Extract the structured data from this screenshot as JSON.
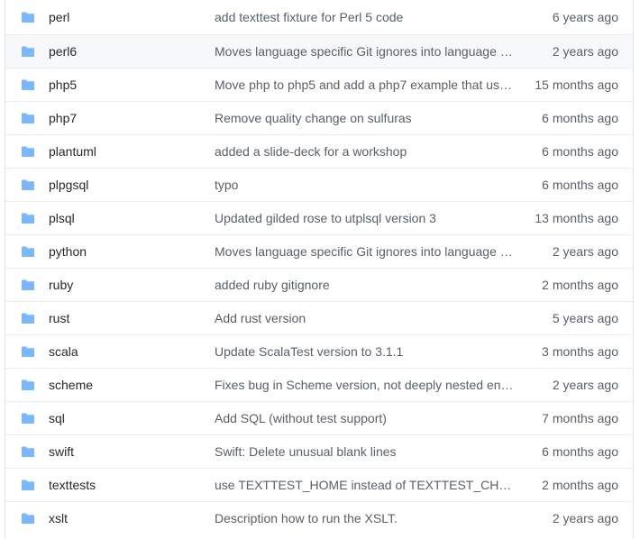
{
  "colors": {
    "folder_icon": "#79b8ff",
    "row_border": "#eaecef",
    "name_text": "#24292e",
    "meta_text": "#586069",
    "hover_bg": "#f6f8fa"
  },
  "rows": [
    {
      "name": "perl",
      "icon": "folder-icon",
      "message": "add texttest fixture for Perl 5 code",
      "age": "6 years ago"
    },
    {
      "name": "perl6",
      "icon": "folder-icon",
      "message": "Moves language specific Git ignores into language s…",
      "age": "2 years ago"
    },
    {
      "name": "php5",
      "icon": "folder-icon",
      "message": "Move php to php5 and add a php7 example that us…",
      "age": "15 months ago"
    },
    {
      "name": "php7",
      "icon": "folder-icon",
      "message": "Remove quality change on sulfuras",
      "age": "6 months ago"
    },
    {
      "name": "plantuml",
      "icon": "folder-icon",
      "message": "added a slide-deck for a workshop",
      "age": "6 months ago"
    },
    {
      "name": "plpgsql",
      "icon": "folder-icon",
      "message": "typo",
      "age": "6 months ago"
    },
    {
      "name": "plsql",
      "icon": "folder-icon",
      "message": "Updated gilded rose to utplsql version 3",
      "age": "13 months ago"
    },
    {
      "name": "python",
      "icon": "folder-icon",
      "message": "Moves language specific Git ignores into language s…",
      "age": "2 years ago"
    },
    {
      "name": "ruby",
      "icon": "folder-icon",
      "message": "added ruby gitignore",
      "age": "2 months ago"
    },
    {
      "name": "rust",
      "icon": "folder-icon",
      "message": "Add rust version",
      "age": "5 years ago"
    },
    {
      "name": "scala",
      "icon": "folder-icon",
      "message": "Update ScalaTest version to 3.1.1",
      "age": "3 months ago"
    },
    {
      "name": "scheme",
      "icon": "folder-icon",
      "message": "Fixes bug in Scheme version, not deeply nested eno…",
      "age": "2 years ago"
    },
    {
      "name": "sql",
      "icon": "folder-icon",
      "message": "Add SQL (without test support)",
      "age": "7 months ago"
    },
    {
      "name": "swift",
      "icon": "folder-icon",
      "message": "Swift: Delete unusual blank lines",
      "age": "6 months ago"
    },
    {
      "name": "texttests",
      "icon": "folder-icon",
      "message": "use TEXTTEST_HOME instead of TEXTTEST_CHECKO…",
      "age": "2 months ago"
    },
    {
      "name": "xslt",
      "icon": "folder-icon",
      "message": "Description how to run the XSLT.",
      "age": "2 years ago"
    }
  ]
}
